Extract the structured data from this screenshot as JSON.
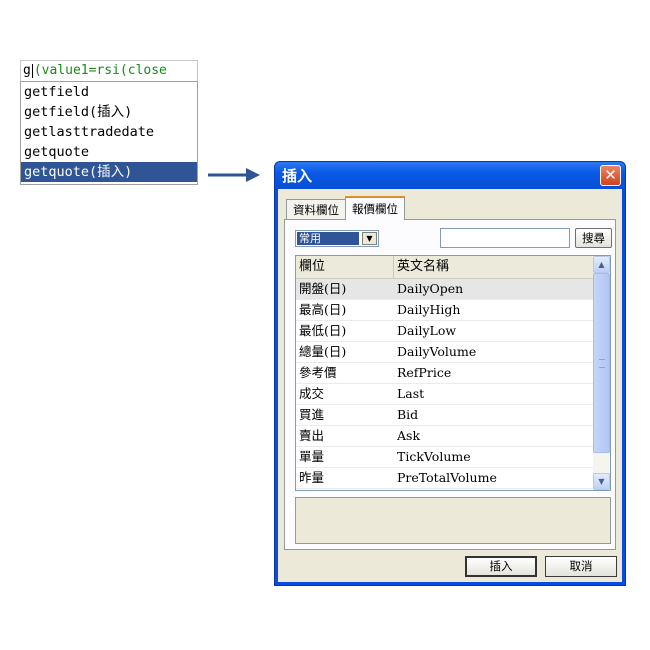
{
  "editor": {
    "typed": "g",
    "rest": "(value1=rsi(close"
  },
  "autocomplete": {
    "items": [
      "getfield",
      "getfield(插入)",
      "getlasttradedate",
      "getquote",
      "getquote(插入)"
    ],
    "selected_index": 4
  },
  "dialog": {
    "title": "插入",
    "close_label": "✕",
    "tabs": [
      "資料欄位",
      "報價欄位"
    ],
    "active_tab": 1,
    "category_value": "常用",
    "search_value": "",
    "search_button": "搜尋",
    "columns": [
      "欄位",
      "英文名稱"
    ],
    "rows": [
      {
        "name": "開盤(日)",
        "eng": "DailyOpen"
      },
      {
        "name": "最高(日)",
        "eng": "DailyHigh"
      },
      {
        "name": "最低(日)",
        "eng": "DailyLow"
      },
      {
        "name": "總量(日)",
        "eng": "DailyVolume"
      },
      {
        "name": "參考價",
        "eng": "RefPrice"
      },
      {
        "name": "成交",
        "eng": "Last"
      },
      {
        "name": "買進",
        "eng": "Bid"
      },
      {
        "name": "賣出",
        "eng": "Ask"
      },
      {
        "name": "單量",
        "eng": "TickVolume"
      },
      {
        "name": "昨量",
        "eng": "PreTotalVolume"
      }
    ],
    "selected_row": 0,
    "insert_button": "插入",
    "cancel_button": "取消"
  },
  "colors": {
    "arrow": "#2f5597",
    "selection": "#2f5597",
    "code_green": "#1a8a1a"
  }
}
